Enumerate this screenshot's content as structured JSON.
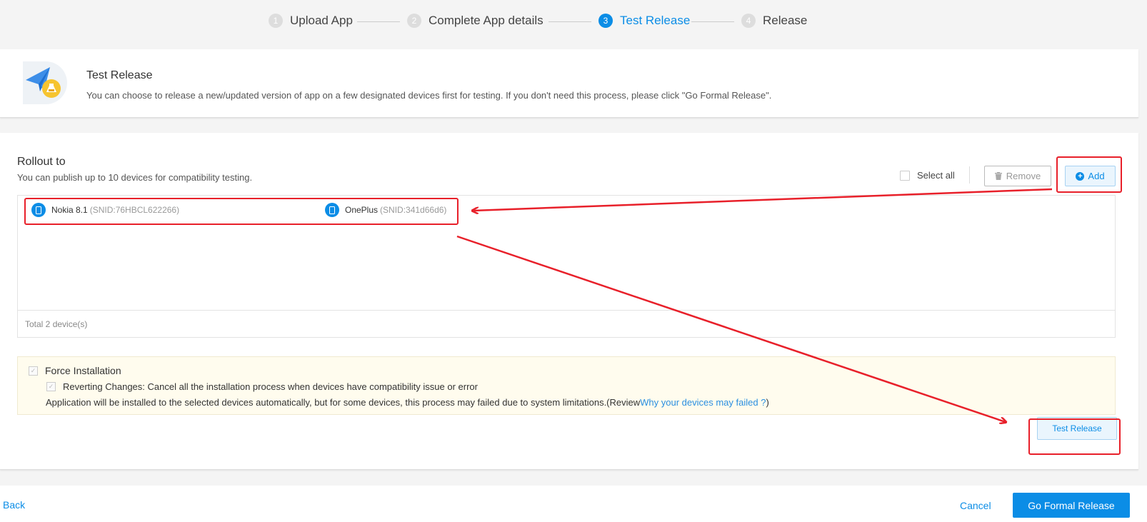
{
  "stepper": {
    "steps": [
      {
        "num": "1",
        "label": "Upload App"
      },
      {
        "num": "2",
        "label": "Complete App details"
      },
      {
        "num": "3",
        "label": "Test Release"
      },
      {
        "num": "4",
        "label": "Release"
      }
    ],
    "active_index": 2
  },
  "info": {
    "title": "Test Release",
    "description": "You can choose to release a new/updated version of app on a few designated devices first for testing. If you don't need this process, please click \"Go Formal Release\".",
    "icon": "paper-plane-flask-icon"
  },
  "rollout": {
    "title": "Rollout to",
    "subtitle": "You can publish up to 10 devices for compatibility testing.",
    "select_all_label": "Select all",
    "remove_label": "Remove",
    "add_label": "Add",
    "devices": [
      {
        "name": "Nokia 8.1",
        "snid": "(SNID:76HBCL622266)"
      },
      {
        "name": "OnePlus",
        "snid": "(SNID:341d66d6)"
      }
    ],
    "total": "Total 2 device(s)"
  },
  "force": {
    "title": "Force Installation",
    "reverting": "Reverting Changes: Cancel all the installation process when devices have compatibility issue or error",
    "note_prefix": "Application will be installed to the selected devices automatically, but for some devices, this process may failed due to system limitations.(Review ",
    "note_link": "Why your devices may failed ?",
    "note_suffix": ")"
  },
  "test_release_label": "Test Release",
  "footer": {
    "back": "Back",
    "cancel": "Cancel",
    "go_formal": "Go Formal Release"
  },
  "colors": {
    "accent": "#0b8de6",
    "annotation": "#e8202a",
    "notice_bg": "#fffcee"
  }
}
